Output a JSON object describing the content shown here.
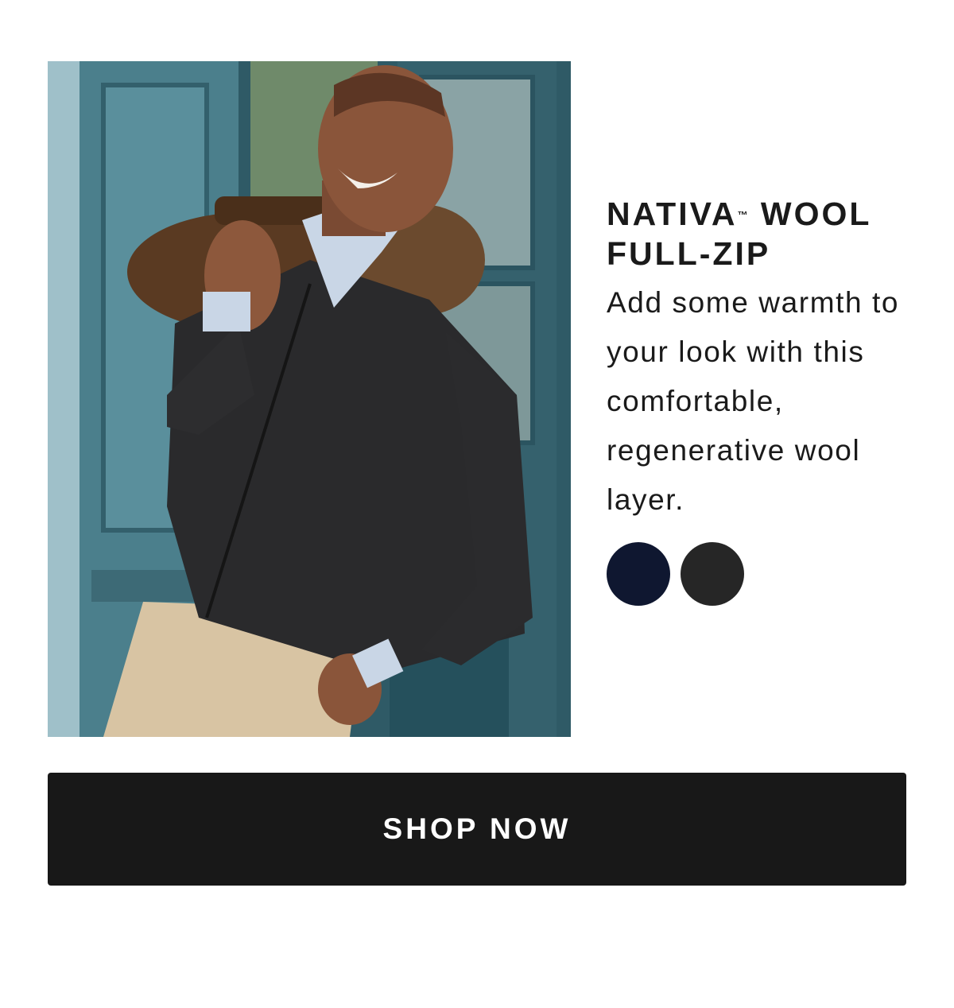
{
  "product": {
    "title_line1_main": "NATIVA",
    "title_trademark": "™",
    "title_line1_rest": " WOOL",
    "title_line2": "FULL-ZIP",
    "description": "Add some warmth to your look with this comfortable, regenerative wool layer.",
    "photo_icon": "product-photo-man-in-wool-full-zip"
  },
  "swatches": [
    {
      "color": "#0f1730"
    },
    {
      "color": "#262626"
    }
  ],
  "cta": {
    "label": "SHOP NOW",
    "background": "#181818"
  }
}
